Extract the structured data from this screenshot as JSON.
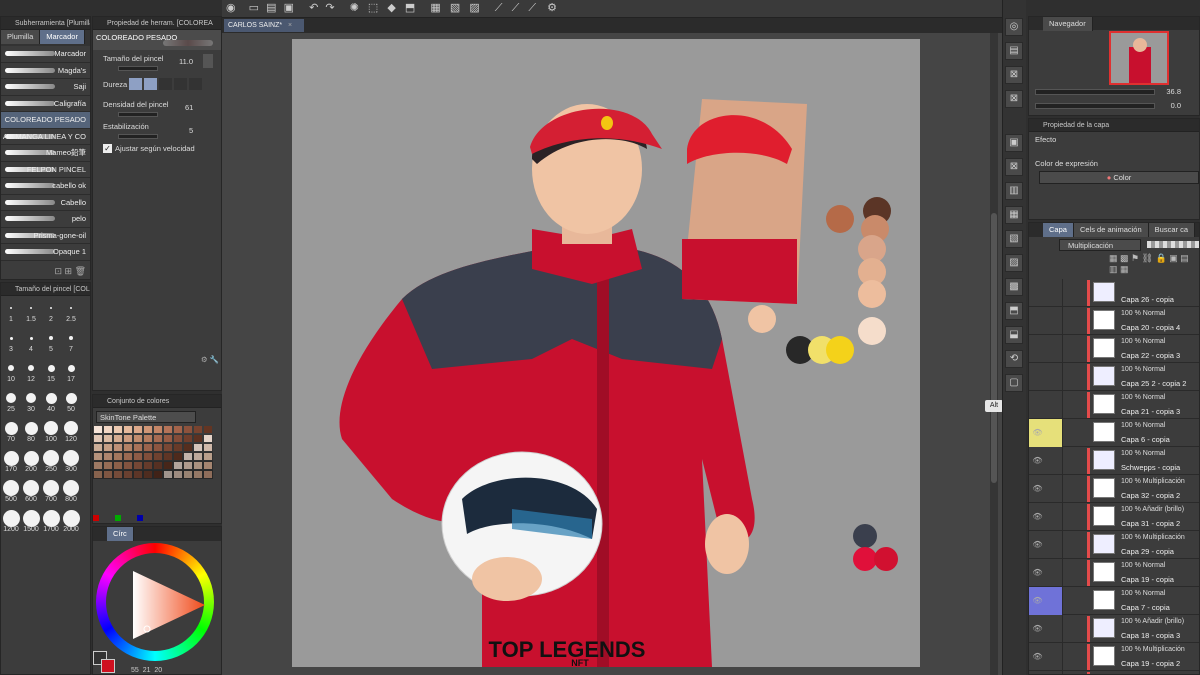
{
  "subtool_panel": {
    "title": "Subherramienta [Plumilla]",
    "tabs": [
      "Plumilla",
      "Marcador"
    ],
    "brushes": [
      "Marcador",
      "Magda's",
      "Saji",
      "Caligrafía",
      "COLOREADO PESADO",
      "AR MANGA LINEA Y CO",
      "Mameo鉛筆",
      "FELPON PINCEL",
      "cabello ok",
      "Cabello",
      "pelo",
      "Prisma-gone-oil",
      "Opaque 1"
    ]
  },
  "tool_property": {
    "title": "Propiedad de herram. [COLOREA",
    "brush_name": "COLOREADO PESADO",
    "size_label": "Tamaño del pincel",
    "size_value": "11.0",
    "hardness_label": "Dureza",
    "density_label": "Densidad del pincel",
    "density_value": "61",
    "stabilization_label": "Estabilización",
    "stabilization_value": "5",
    "velocity_label": "Ajustar según velocidad"
  },
  "brush_size_panel": {
    "title": "Tamaño del pincel [COLOREA",
    "sizes": [
      "1",
      "1.5",
      "2",
      "2.5",
      "3",
      "4",
      "5",
      "7",
      "10",
      "12",
      "15",
      "17",
      "25",
      "30",
      "40",
      "50",
      "70",
      "80",
      "100",
      "120",
      "170",
      "200",
      "250",
      "300",
      "500",
      "600",
      "700",
      "800",
      "1200",
      "1500",
      "1700",
      "2000"
    ]
  },
  "color_set": {
    "title": "Conjunto de colores",
    "palette_name": "SkinTone Palette"
  },
  "color_wheel": {
    "tab_label": "Círc",
    "values": [
      "55",
      "21",
      "20"
    ]
  },
  "canvas_tab": "CARLOS SAINZ*",
  "artwork": {
    "logo_line1": "TOP LEGENDS",
    "logo_line2": "NFT"
  },
  "alt_badge": "Alt",
  "navigator": {
    "title": "Navegador",
    "zoom": "36.8",
    "rotation": "0.0"
  },
  "layer_property": {
    "title": "Propiedad de la capa",
    "effect_label": "Efecto",
    "expression_label": "Color de expresión",
    "color_button": "Color"
  },
  "layers_panel": {
    "tabs": [
      "Capa",
      "Cels de animación",
      "Buscar ca"
    ],
    "blend_mode": "Multiplicación",
    "layers": [
      {
        "mode": "",
        "name": "Capa 26 - copia"
      },
      {
        "mode": "100 % Normal",
        "name": "Capa 20 - copia 4"
      },
      {
        "mode": "100 % Normal",
        "name": "Capa 22 - copia 3"
      },
      {
        "mode": "100 % Normal",
        "name": "Capa 25 2 - copia 2"
      },
      {
        "mode": "100 % Normal",
        "name": "Capa 21 - copia 3"
      },
      {
        "mode": "100 % Normal",
        "name": "Capa 6 - copia"
      },
      {
        "mode": "100 % Normal",
        "name": "Schwepps - copia"
      },
      {
        "mode": "100 % Multiplicación",
        "name": "Capa 32 - copia 2"
      },
      {
        "mode": "100 % Añadir (brillo)",
        "name": "Capa 31 - copia 2"
      },
      {
        "mode": "100 % Multiplicación",
        "name": "Capa 29 - copia"
      },
      {
        "mode": "100 % Normal",
        "name": "Capa 19 - copia"
      },
      {
        "mode": "100 % Normal",
        "name": "Capa 7 - copia"
      },
      {
        "mode": "100 % Añadir (brillo)",
        "name": "Capa 18 - copia 3"
      },
      {
        "mode": "100 % Multiplicación",
        "name": "Capa 19 - copia 2"
      },
      {
        "mode": "100 % Normal",
        "name": ""
      }
    ]
  },
  "colors": {
    "accent": "#5f6f8a",
    "canvas_bg": "#9a9a9a",
    "suit_red": "#c8102e",
    "suit_dark": "#3a3f4d"
  }
}
